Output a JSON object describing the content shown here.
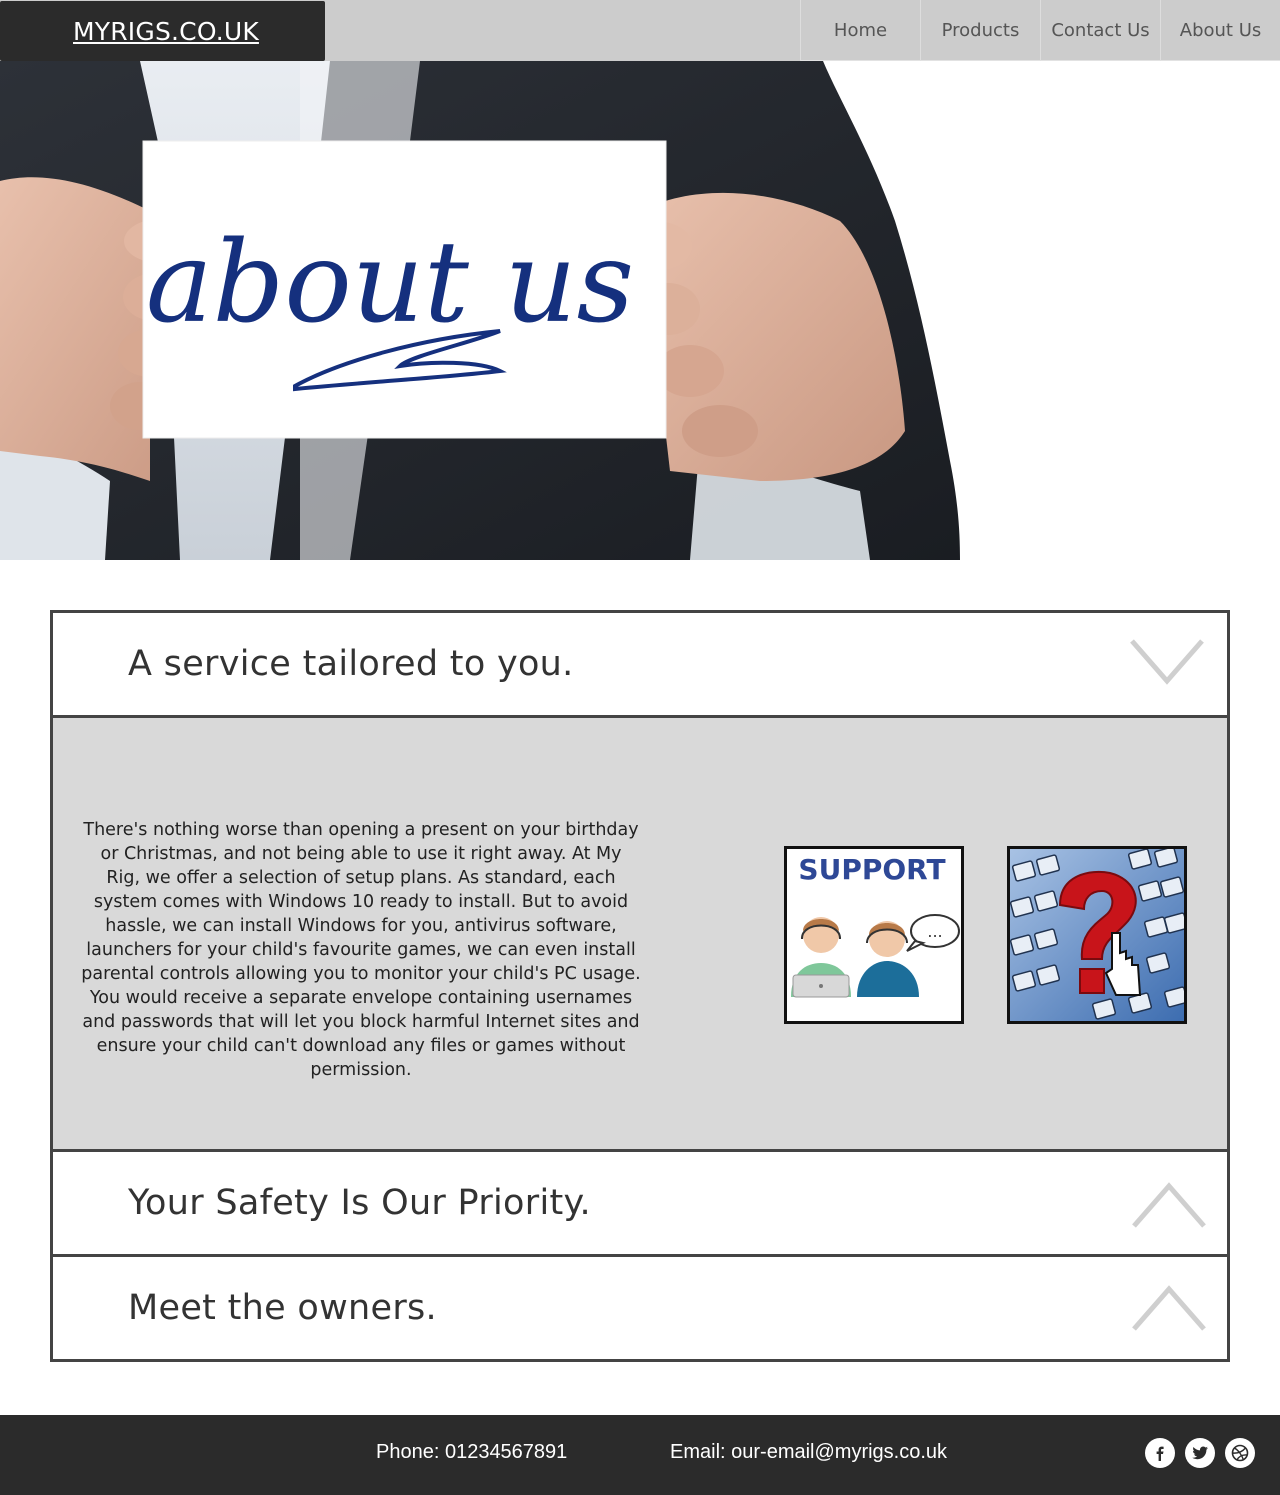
{
  "header": {
    "brand": "MYRIGS.CO.UK",
    "nav": [
      "Home",
      "Products",
      "Contact Us",
      "About Us"
    ]
  },
  "hero": {
    "card_text": "about us"
  },
  "accordion": {
    "sections": [
      {
        "title": "A service tailored to you.",
        "expanded": true,
        "body": "There's nothing worse than opening a present on your birthday or Christmas, and not being able to use it right away. At My Rig, we offer a selection of setup plans. As standard, each system comes with Windows 10 ready to install. But to avoid hassle, we can install Windows for you, antivirus software, launchers for your child's favourite games, we can even install parental controls allowing you to monitor your child's PC usage. You would receive a separate envelope containing usernames and passwords that will let you block harmful Internet sites and ensure your child can't download any files or games without permission.",
        "images": [
          {
            "label": "SUPPORT",
            "icon": "support-agents-icon"
          },
          {
            "icon": "keyboard-help-icon"
          }
        ]
      },
      {
        "title": "Your Safety Is Our Priority.",
        "expanded": false
      },
      {
        "title": "Meet the owners.",
        "expanded": false
      }
    ]
  },
  "footer": {
    "phone": "Phone: 01234567891",
    "email": "Email: our-email@myrigs.co.uk",
    "social": [
      "facebook-icon",
      "twitter-icon",
      "dribbble-icon"
    ]
  },
  "colors": {
    "header_bg": "#cccccc",
    "brand_bg": "#2b2b2b",
    "panel_bg": "#d9d9d9",
    "border": "#444444",
    "footer_bg": "#2b2b2b",
    "card_ink": "#15307e"
  }
}
